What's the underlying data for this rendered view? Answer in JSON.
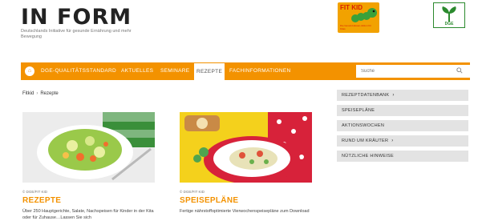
{
  "header": {
    "logo_text": "IN FORM",
    "logo_tagline": "Deutschlands Initiative für gesunde Ernährung und mehr Bewegung",
    "fitkid_logo_text": "FIT KID",
    "fitkid_logo_subtext": "Die Gesund-Essen-Aktion für Kitas",
    "dge_logo_text": "DGE"
  },
  "nav": {
    "items": [
      {
        "label": "DGE-QUALITÄTSSTANDARD",
        "active": false
      },
      {
        "label": "AKTUELLES",
        "active": false
      },
      {
        "label": "SEMINARE",
        "active": false
      },
      {
        "label": "REZEPTE",
        "active": true
      },
      {
        "label": "FACHINFORMATIONEN",
        "active": false
      }
    ],
    "search_placeholder": "Suche"
  },
  "breadcrumb": {
    "items": [
      "Fitkid",
      "Rezepte"
    ]
  },
  "cards": [
    {
      "credit": "© DGE/FIT KID",
      "title": "REZEPTE",
      "description": "Über 250 Hauptgerichte, Salate, Nachspeisen für Kinder in der Kita oder für Zuhause…Lassen Sie sich"
    },
    {
      "credit": "© DGE/FIT KID",
      "title": "SPEISEPLÄNE",
      "description": "Fertige nährstoffoptimierte Vierwochenspeisepläne zum Download"
    }
  ],
  "sidebar": {
    "items": [
      {
        "label": "REZEPTDATENBANK",
        "chevron": "›"
      },
      {
        "label": "SPEISEPLÄNE",
        "chevron": ""
      },
      {
        "label": "AKTIONSWOCHEN",
        "chevron": ""
      },
      {
        "label": "RUND UM KRÄUTER",
        "chevron": "›"
      },
      {
        "label": "NÜTZLICHE HINWEISE",
        "chevron": ""
      }
    ]
  },
  "colors": {
    "accent": "#f39200",
    "sidebar_bg": "#e3e3e3",
    "dge_green": "#2b8a2e"
  }
}
